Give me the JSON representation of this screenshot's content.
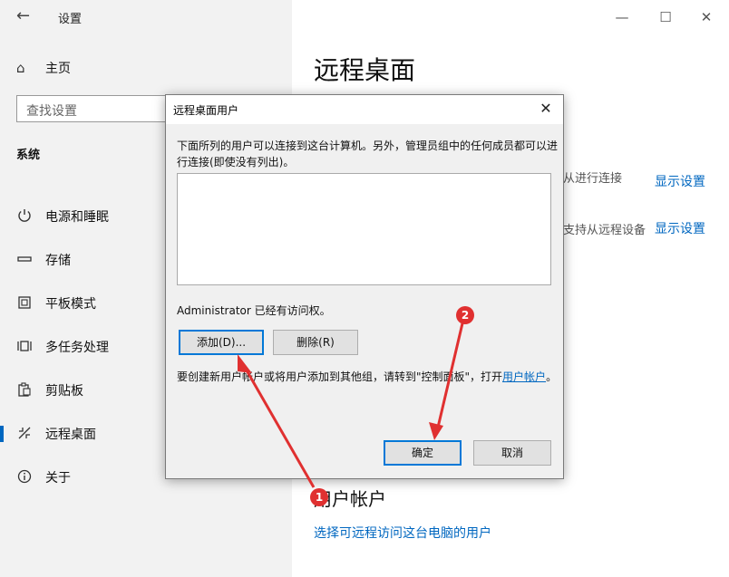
{
  "window": {
    "title": "设置",
    "controls": {
      "minimize": "—",
      "maximize": "☐",
      "close": "✕"
    }
  },
  "sidebar": {
    "home_label": "主页",
    "search_placeholder": "查找设置",
    "section_label": "系统",
    "items": [
      {
        "label": "电源和睡眠",
        "icon": "power-icon"
      },
      {
        "label": "存储",
        "icon": "storage-icon"
      },
      {
        "label": "平板模式",
        "icon": "tablet-mode-icon"
      },
      {
        "label": "多任务处理",
        "icon": "multitasking-icon"
      },
      {
        "label": "剪贴板",
        "icon": "clipboard-icon"
      },
      {
        "label": "远程桌面",
        "icon": "remote-desktop-icon",
        "active": true
      },
      {
        "label": "关于",
        "icon": "info-icon"
      }
    ]
  },
  "main": {
    "title": "远程桌面",
    "partial_text_1": "从进行连接",
    "link_1": "显示设置",
    "partial_text_2": "支持从远程设备",
    "link_2": "显示设置",
    "section_user_accounts": "用户帐户",
    "link_select_users": "选择可远程访问这台电脑的用户"
  },
  "dialog": {
    "title": "远程桌面用户",
    "description": "下面所列的用户可以连接到这台计算机。另外，管理员组中的任何成员都可以进行连接(即使没有列出)。",
    "users": [],
    "access_info": "Administrator 已经有访问权。",
    "add_button": "添加(D)...",
    "remove_button": "删除(R)",
    "note_prefix": "要创建新用户帐户或将用户添加到其他组，请转到\"控制面板\"，打开",
    "note_link": "用户帐户",
    "note_suffix": "。",
    "ok_button": "确定",
    "cancel_button": "取消"
  },
  "annotations": {
    "badge_1": "1",
    "badge_2": "2",
    "color": "#e03030"
  },
  "colors": {
    "accent": "#0067c0",
    "sidebar_bg": "#f2f2f2",
    "dialog_bg": "#f0f0f0"
  }
}
